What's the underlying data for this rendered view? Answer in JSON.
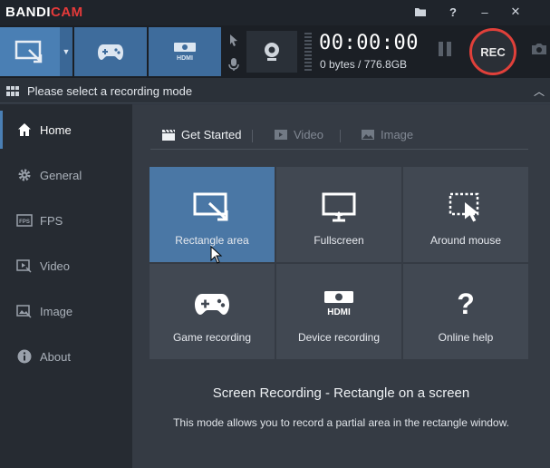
{
  "app": {
    "logo_part1": "BANDI",
    "logo_part2": "CAM"
  },
  "titlebar": {
    "folder_icon": "folder-icon",
    "help_label": "?",
    "minimize_label": "–",
    "close_label": "✕"
  },
  "toolbar": {
    "modes": [
      "rectangle-mode",
      "game-mode",
      "hdmi-mode"
    ],
    "timer": "00:00:00",
    "size_info": "0 bytes / 776.8GB",
    "rec_label": "REC"
  },
  "mode_header": {
    "text": "Please select a recording mode"
  },
  "sidebar": {
    "items": [
      {
        "label": "Home",
        "icon": "home-icon"
      },
      {
        "label": "General",
        "icon": "gear-icon"
      },
      {
        "label": "FPS",
        "icon": "fps-icon"
      },
      {
        "label": "Video",
        "icon": "video-icon"
      },
      {
        "label": "Image",
        "icon": "image-icon"
      },
      {
        "label": "About",
        "icon": "info-icon"
      }
    ]
  },
  "tabs": [
    {
      "label": "Get Started",
      "icon": "clapper-icon"
    },
    {
      "label": "Video",
      "icon": "video-icon"
    },
    {
      "label": "Image",
      "icon": "image-icon"
    }
  ],
  "tiles": [
    {
      "label": "Rectangle area",
      "icon": "rectangle-area-icon"
    },
    {
      "label": "Fullscreen",
      "icon": "monitor-icon"
    },
    {
      "label": "Around mouse",
      "icon": "around-mouse-icon"
    },
    {
      "label": "Game recording",
      "icon": "gamepad-icon"
    },
    {
      "label": "Device recording",
      "icon": "hdmi-icon"
    },
    {
      "label": "Online help",
      "icon": "question-icon"
    }
  ],
  "description": {
    "title": "Screen Recording - Rectangle on a screen",
    "text": "This mode allows you to record a partial area in the rectangle window."
  },
  "colors": {
    "accent": "#4a7fb4",
    "rec_ring": "#e0403a",
    "logo_red": "#e53a3a"
  }
}
